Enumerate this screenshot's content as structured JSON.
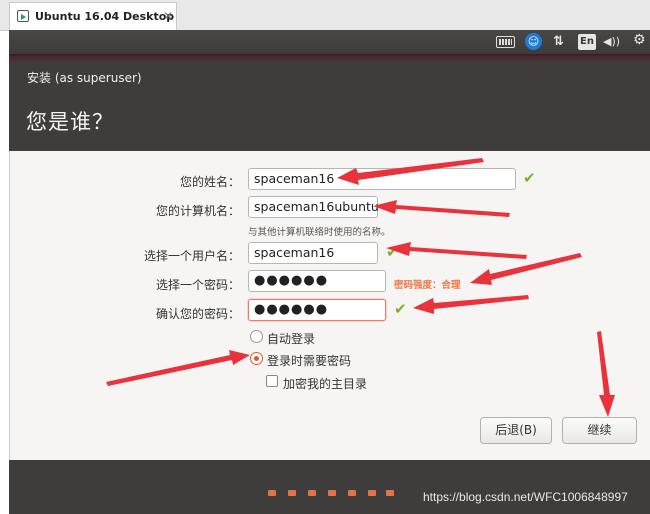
{
  "browser_tab": {
    "title": "Ubuntu 16.04 Desktop",
    "close": "✕"
  },
  "panel": {
    "lang": "En",
    "sort_icon": "⇅",
    "volume_icon": "◀))",
    "gear_icon": "⚙",
    "access_icon": "☺"
  },
  "window": {
    "subtitle": "安装 (as superuser)",
    "title": "您是谁？"
  },
  "form": {
    "name_label": "您的姓名：",
    "name_value": "spaceman16",
    "computer_label": "您的计算机名：",
    "computer_value": "spaceman16ubuntu",
    "computer_hint": "与其他计算机联络时使用的名称。",
    "user_label": "选择一个用户名：",
    "user_value": "spaceman16",
    "pwd_label": "选择一个密码：",
    "pwd_value": "●●●●●●",
    "strength": "密码强度：合理",
    "confirm_label": "确认您的密码：",
    "confirm_value": "●●●●●●",
    "check": "✔"
  },
  "options": {
    "auto_login": "自动登录",
    "require_pwd": "登录时需要密码",
    "encrypt_home": "加密我的主目录",
    "selected": "require_pwd"
  },
  "buttons": {
    "back": "后退(B)",
    "continue": "继续"
  },
  "footer": {
    "watermark": "https://blog.csdn.net/WFC1006848997",
    "progress_dots": 7
  },
  "colors": {
    "accent": "#e05a2b",
    "arrow": "#e8323c",
    "ok": "#7ab227",
    "panel": "#3c3b37"
  }
}
